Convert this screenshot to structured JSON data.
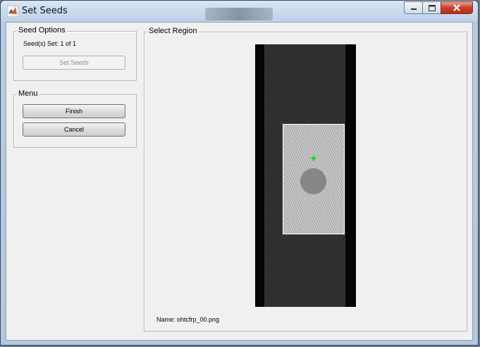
{
  "window": {
    "title": "Set Seeds",
    "icons": {
      "app": "matlab-icon",
      "minimize": "minimize-icon",
      "maximize": "maximize-icon",
      "close": "close-icon"
    }
  },
  "seed_options": {
    "label": "Seed Options",
    "status": "Seed(s) Set: 1 of 1",
    "set_seeds_label": "Set Seeds"
  },
  "menu": {
    "label": "Menu",
    "finish_label": "Finish",
    "cancel_label": "Cancel"
  },
  "region": {
    "label": "Select Region",
    "image_name": "Name: ohtcfrp_00.png"
  },
  "colors": {
    "seed_marker": "#00e600",
    "roi_border": "#ffffff",
    "titlebar": "#bcd1e8"
  }
}
